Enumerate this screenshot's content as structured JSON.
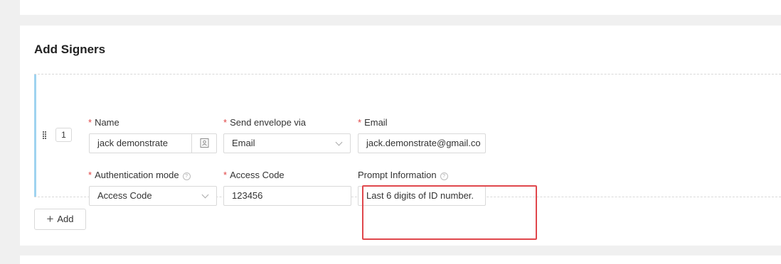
{
  "section": {
    "title": "Add Signers"
  },
  "signer": {
    "index": "1",
    "name": {
      "required": "*",
      "label": "Name",
      "value": "jack demonstrate"
    },
    "send_via": {
      "required": "*",
      "label": "Send envelope via",
      "value": "Email"
    },
    "email": {
      "required": "*",
      "label": "Email",
      "value": "jack.demonstrate@gmail.co"
    },
    "auth_mode": {
      "required": "*",
      "label": "Authentication mode",
      "value": "Access Code"
    },
    "access_code": {
      "required": "*",
      "label": "Access Code",
      "value": "123456"
    },
    "prompt_info": {
      "label": "Prompt Information",
      "value": "Last 6 digits of ID number."
    },
    "help_glyph": "?",
    "icons": {
      "contact": "contact-book-icon",
      "dropdown": "chevron-down-icon",
      "help": "help-circle-icon",
      "drag": "drag-handle-icon"
    }
  },
  "actions": {
    "add_symbol": "+",
    "add_label": "Add"
  },
  "colors": {
    "required": "#e04545",
    "accent_bar": "#9fd3f0",
    "highlight": "#e0474c"
  }
}
